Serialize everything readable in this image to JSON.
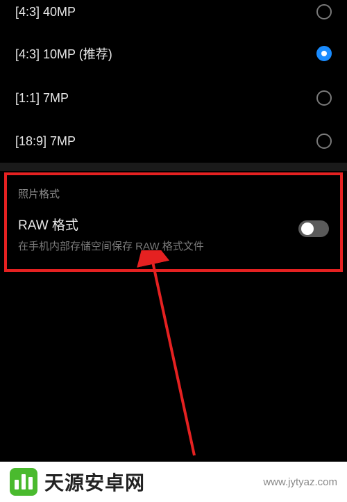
{
  "resolution": {
    "options": [
      {
        "label": "[4:3] 40MP",
        "selected": false
      },
      {
        "label": "[4:3] 10MP (推荐)",
        "selected": true
      },
      {
        "label": "[1:1] 7MP",
        "selected": false
      },
      {
        "label": "[18:9] 7MP",
        "selected": false
      }
    ]
  },
  "photoFormat": {
    "sectionTitle": "照片格式",
    "rawLabel": "RAW 格式",
    "rawDesc": "在手机内部存储空间保存 RAW 格式文件",
    "rawEnabled": false
  },
  "watermark": {
    "brand": "天源安卓网",
    "url": "www.jytyaz.com"
  }
}
